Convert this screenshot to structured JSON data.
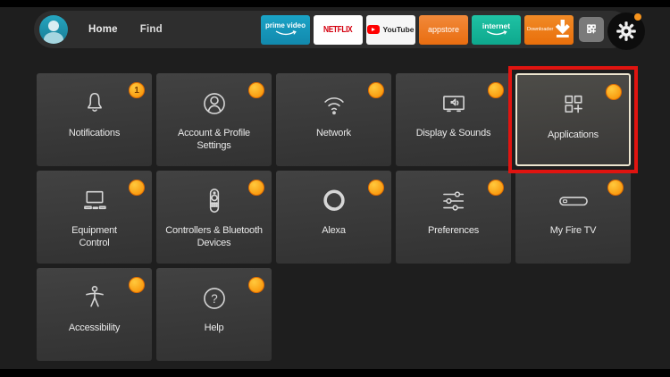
{
  "topbar": {
    "nav": [
      {
        "label": "Home"
      },
      {
        "label": "Find"
      }
    ],
    "shortcuts": [
      {
        "name": "prime-video",
        "label": "prime video",
        "bg": "#1399bb",
        "fg": "#ffffff"
      },
      {
        "name": "netflix",
        "label": "NETFLIX",
        "bg": "#ffffff",
        "fg": "#d4000f"
      },
      {
        "name": "youtube",
        "label": "YouTube",
        "bg": "#f6f6f6",
        "fg": "#232323"
      },
      {
        "name": "appstore",
        "label": "appstore",
        "bg": "#ec7b22",
        "fg": "#ffffff"
      },
      {
        "name": "internet",
        "label": "internet",
        "bg": "#14b59b",
        "fg": "#ffffff"
      },
      {
        "name": "downloader",
        "label": "Downloader",
        "bg": "#ef7d15",
        "fg": "#ffffff"
      }
    ],
    "apps_grid_button": {
      "icon": "apps-grid-icon"
    },
    "settings_button": {
      "icon": "gear-icon",
      "has_notification_dot": true
    }
  },
  "tiles": [
    {
      "label": "Notifications",
      "icon": "bell-icon",
      "badge": "1"
    },
    {
      "label": "Account & Profile\nSettings",
      "icon": "account-icon"
    },
    {
      "label": "Network",
      "icon": "wifi-icon"
    },
    {
      "label": "Display & Sounds",
      "icon": "display-sounds-icon"
    },
    {
      "label": "Applications",
      "icon": "applications-icon",
      "highlighted": true
    },
    {
      "label": "Equipment\nControl",
      "icon": "equipment-control-icon"
    },
    {
      "label": "Controllers & Bluetooth\nDevices",
      "icon": "remote-icon"
    },
    {
      "label": "Alexa",
      "icon": "alexa-icon"
    },
    {
      "label": "Preferences",
      "icon": "sliders-icon"
    },
    {
      "label": "My Fire TV",
      "icon": "firetv-stick-icon"
    },
    {
      "label": "Accessibility",
      "icon": "accessibility-icon"
    },
    {
      "label": "Help",
      "icon": "help-icon"
    }
  ],
  "colors": {
    "page_bg": "#1e1e1e",
    "topbar_pill": "#2e2e2e",
    "tile_bg": "#3a3a3a",
    "focus_border": "#ede5cf",
    "annotation_red": "#e01410",
    "badge_orange": "#f78b00",
    "notification_dot": "#f7941d",
    "avatar_teal": "#1f97ae"
  }
}
